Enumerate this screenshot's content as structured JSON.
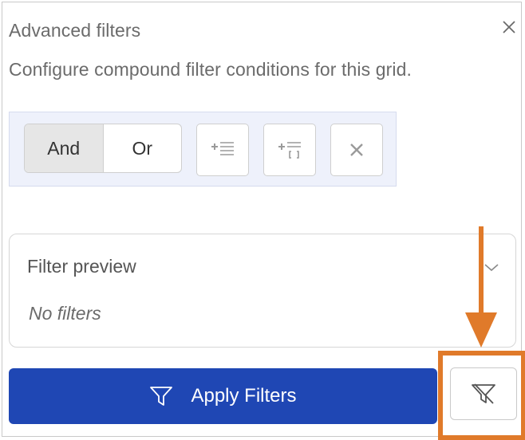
{
  "header": {
    "title": "Advanced filters",
    "subtitle": "Configure compound filter conditions for this grid."
  },
  "toolbar": {
    "logic": {
      "options": [
        "And",
        "Or"
      ],
      "selected": "And"
    },
    "add_rule_icon": "add-rule-icon",
    "add_group_icon": "add-group-icon",
    "remove_icon": "close-icon"
  },
  "preview": {
    "title": "Filter preview",
    "empty_text": "No filters"
  },
  "actions": {
    "apply_label": "Apply Filters",
    "clear_icon": "filter-clear-icon"
  },
  "colors": {
    "primary": "#1f47b4",
    "annotation": "#e07a2a",
    "toolbar_bg": "#eef1fb"
  }
}
